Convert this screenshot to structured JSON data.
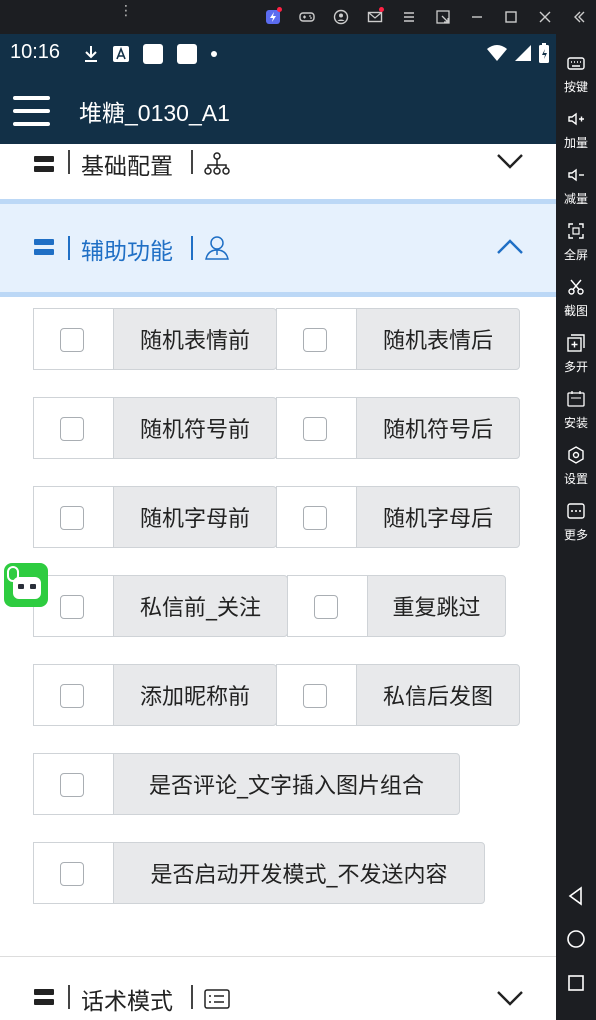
{
  "topbar": {
    "icons": [
      "more-vertical-icon",
      "app-icon",
      "gamepad-icon",
      "account-icon",
      "mail-icon",
      "menu-icon",
      "resize-icon",
      "minimize-icon",
      "maximize-icon",
      "close-icon",
      "collapse-sidebar-icon"
    ]
  },
  "statusbar": {
    "time": "10:16"
  },
  "appbar": {
    "title": "堆糖_0130_A1"
  },
  "sections": {
    "basic": {
      "title": "基础配置"
    },
    "assist": {
      "title": "辅助功能"
    },
    "script": {
      "title": "话术模式"
    }
  },
  "options": [
    {
      "left": "随机表情前",
      "right": "随机表情后"
    },
    {
      "left": "随机符号前",
      "right": "随机符号后"
    },
    {
      "left": "随机字母前",
      "right": "随机字母后"
    },
    {
      "left": "私信前_关注",
      "right": "重复跳过"
    },
    {
      "left": "添加昵称前",
      "right": "私信后发图"
    },
    {
      "single": "是否评论_文字插入图片组合"
    },
    {
      "single": "是否启动开发模式_不发送内容"
    }
  ],
  "sidebar": {
    "keys": "按键",
    "vol_up": "加量",
    "vol_down": "减量",
    "fullscreen": "全屏",
    "screenshot": "截图",
    "multi": "多开",
    "install": "安装",
    "settings": "设置",
    "more": "更多"
  },
  "colors": {
    "appbar": "#123047",
    "accent": "#1f6fc5",
    "section_active_bg": "#e6f1fd"
  }
}
